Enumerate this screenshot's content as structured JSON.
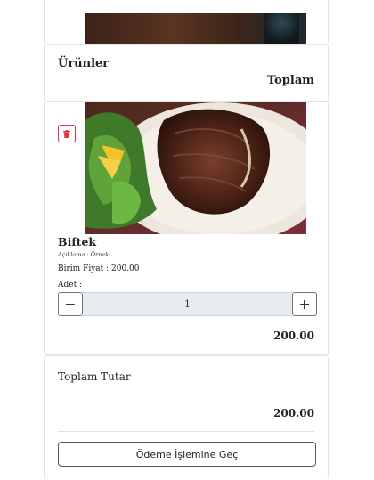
{
  "cart": {
    "products_title": "Ürünler",
    "total_header": "Toplam"
  },
  "item": {
    "name": "Biftek",
    "description": "Açıklama : Örnek",
    "unit_price": "Birim Fiyat : 200.00",
    "quantity_label": "Adet :",
    "quantity": "1",
    "minus_label": "−",
    "plus_label": "+",
    "line_total": "200.00",
    "image_icon": "steak-photo",
    "delete_icon": "trash-icon",
    "delete_color": "#dc3545"
  },
  "summary": {
    "title": "Toplam Tutar",
    "amount": "200.00",
    "checkout_label": "Ödeme İşlemine Geç"
  }
}
